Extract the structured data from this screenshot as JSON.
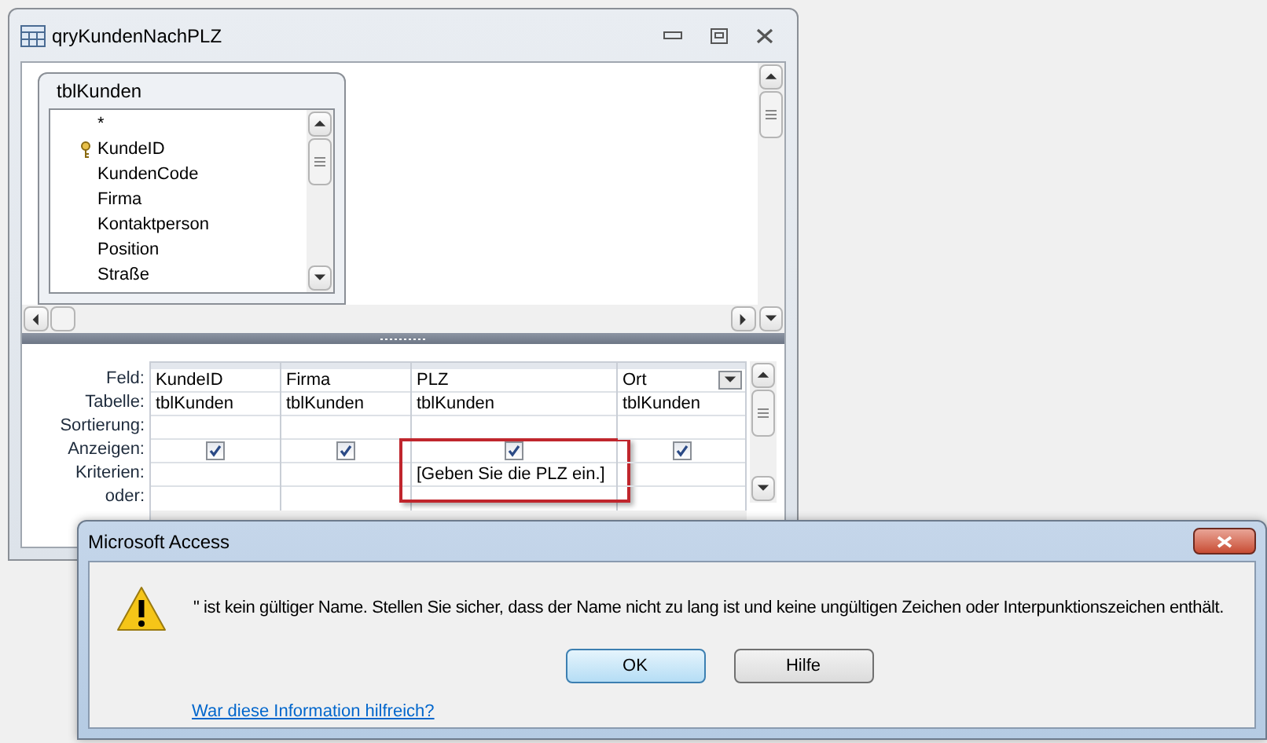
{
  "query_window": {
    "title": "qryKundenNachPLZ",
    "table_box": {
      "title": "tblKunden",
      "fields": [
        {
          "name": "*",
          "primary_key": false
        },
        {
          "name": "KundeID",
          "primary_key": true
        },
        {
          "name": "KundenCode",
          "primary_key": false
        },
        {
          "name": "Firma",
          "primary_key": false
        },
        {
          "name": "Kontaktperson",
          "primary_key": false
        },
        {
          "name": "Position",
          "primary_key": false
        },
        {
          "name": "Straße",
          "primary_key": false
        }
      ]
    },
    "grid": {
      "row_labels": [
        "Feld:",
        "Tabelle:",
        "Sortierung:",
        "Anzeigen:",
        "Kriterien:",
        "oder:"
      ],
      "columns": [
        {
          "field": "KundeID",
          "table": "tblKunden",
          "show": true,
          "highlighted": false,
          "dropdown": false
        },
        {
          "field": "Firma",
          "table": "tblKunden",
          "show": true,
          "highlighted": false,
          "dropdown": false
        },
        {
          "field": "PLZ",
          "table": "tblKunden",
          "show": true,
          "criteria": "[Geben Sie die PLZ ein.]",
          "highlighted": true,
          "dropdown": false
        },
        {
          "field": "Ort",
          "table": "tblKunden",
          "show": true,
          "highlighted": false,
          "dropdown": true
        }
      ]
    }
  },
  "dialog": {
    "title": "Microsoft Access",
    "message": "\" ist kein gültiger Name. Stellen Sie sicher, dass der Name nicht zu lang ist und keine ungültigen Zeichen oder Interpunktionszeichen enthält.",
    "buttons": [
      {
        "label": "OK",
        "default": true
      },
      {
        "label": "Hilfe",
        "default": false
      }
    ],
    "link": "War diese Information hilfreich?"
  }
}
